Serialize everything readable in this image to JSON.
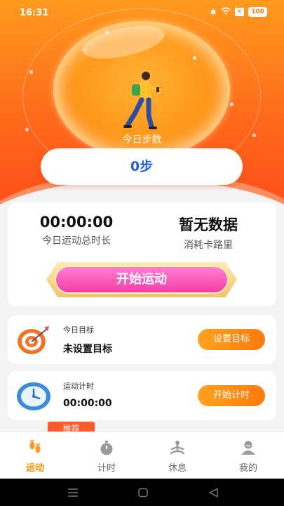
{
  "status_bar": {
    "time": "16:31",
    "battery": "100"
  },
  "hero": {
    "steps_label": "今日步数",
    "steps_value": "0步"
  },
  "stats": {
    "duration_value": "00:00:00",
    "duration_label": "今日运动总时长",
    "calories_value": "暂无数据",
    "calories_label": "消耗卡路里",
    "start_button": "开始运动"
  },
  "goal": {
    "title": "今日目标",
    "value": "未设置目标",
    "button": "设置目标"
  },
  "timer": {
    "title": "运动计时",
    "value": "00:00:00",
    "button": "开始计时"
  },
  "recommend_badge": "推荐",
  "tabs": [
    {
      "label": "运动",
      "icon": "footprints-icon",
      "active": true
    },
    {
      "label": "计时",
      "icon": "stopwatch-icon",
      "active": false
    },
    {
      "label": "休息",
      "icon": "meditation-icon",
      "active": false
    },
    {
      "label": "我的",
      "icon": "profile-icon",
      "active": false
    }
  ],
  "colors": {
    "accent": "#ff8a00",
    "steps_text": "#1f5fe0",
    "start_button": "#f33ea8"
  }
}
